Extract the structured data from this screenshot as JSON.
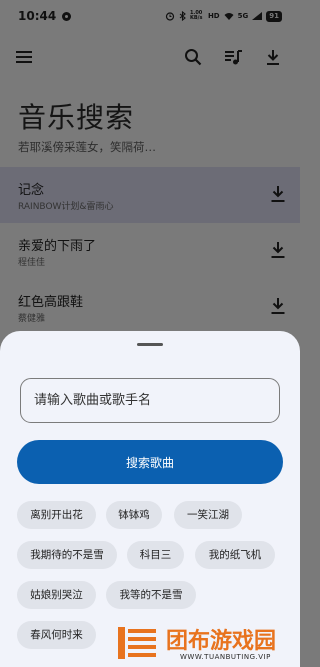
{
  "status_bar": {
    "time": "10:44",
    "net_speed": "1.00 KB/s",
    "network_labels": [
      "HD",
      "5G"
    ],
    "battery": "91"
  },
  "app_bar": {
    "icons": [
      "menu-icon",
      "search-icon",
      "playlist-icon",
      "download-icon"
    ]
  },
  "page": {
    "title": "音乐搜索",
    "subtitle": "若耶溪傍采莲女，笑隔荷…"
  },
  "songs": [
    {
      "title": "记念",
      "artist": "RAINBOW计划&雷雨心",
      "selected": true
    },
    {
      "title": "亲爱的下雨了",
      "artist": "程佳佳",
      "selected": false
    },
    {
      "title": "红色高跟鞋",
      "artist": "蔡健雅",
      "selected": false
    }
  ],
  "sheet": {
    "search_placeholder": "请输入歌曲或歌手名",
    "search_button_label": "搜索歌曲",
    "suggestions": [
      "离别开出花",
      "钵钵鸡",
      "一笑江湖",
      "我期待的不是雪",
      "科目三",
      "我的纸飞机",
      "姑娘别哭泣",
      "我等的不是雪",
      "春风何时来"
    ]
  },
  "watermark": {
    "title": "团布游戏园",
    "url": "WWW.TUANBUTING.VIP"
  },
  "colors": {
    "scrim": "#7a7a7a",
    "selected_row": "#6c6c76",
    "sheet_bg": "#f1f3fa",
    "primary": "#0b60b0",
    "chip_bg": "#e0e3ea",
    "watermark_orange": "#e8731e"
  }
}
